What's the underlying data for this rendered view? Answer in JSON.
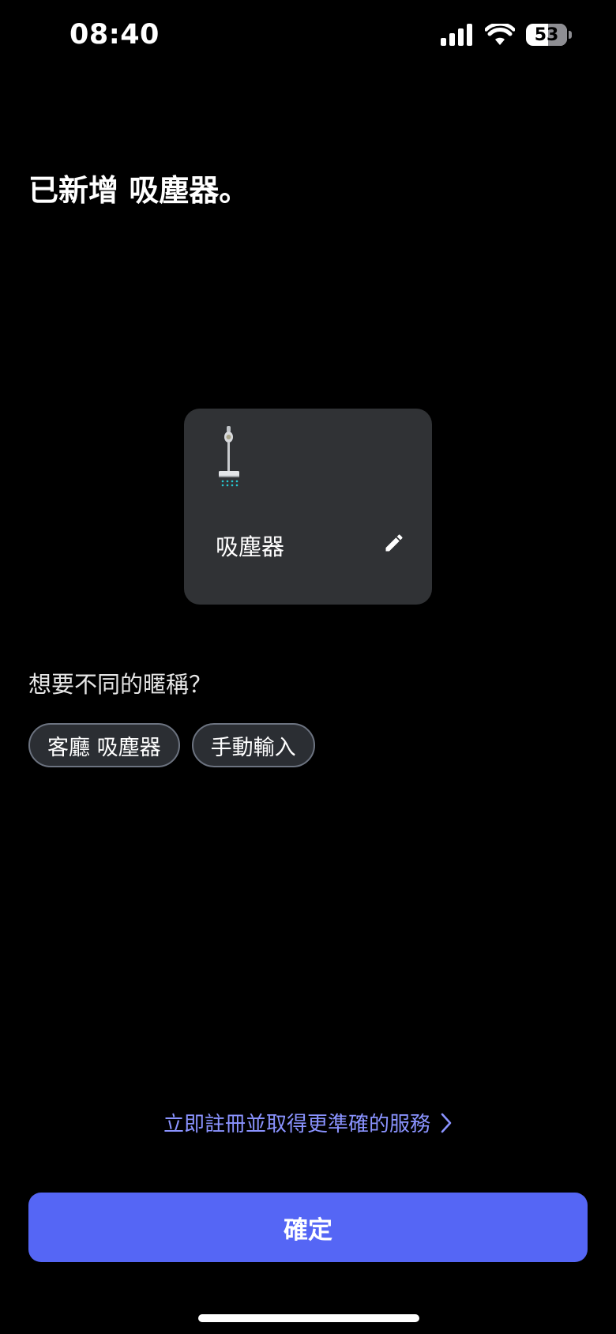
{
  "status_bar": {
    "time": "08:40",
    "battery_level": "53",
    "battery_percent": 53,
    "signal_icon": "cellular-signal-icon",
    "wifi_icon": "wifi-icon"
  },
  "title": "已新增 吸塵器。",
  "device_card": {
    "name": "吸塵器",
    "image_icon": "vacuum-cleaner-icon",
    "edit_icon": "pencil-icon"
  },
  "nickname": {
    "prompt": "想要不同的暱稱？",
    "options": [
      "客廳 吸塵器",
      "手動輸入"
    ]
  },
  "register_link": {
    "label": "立即註冊並取得更準確的服務",
    "icon": "chevron-right-icon"
  },
  "confirm_button": {
    "label": "確定"
  },
  "colors": {
    "background": "#000000",
    "card": "#303235",
    "accent": "#5566f5",
    "link": "#8a93ff"
  }
}
